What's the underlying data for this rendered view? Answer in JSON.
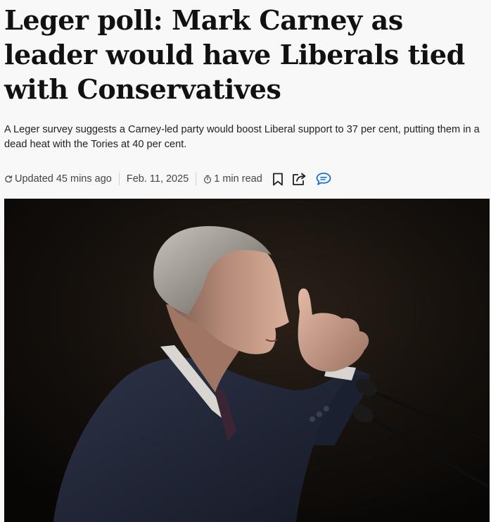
{
  "article": {
    "headline": "Leger poll: Mark Carney as leader would have Liberals tied with Conservatives",
    "deck": "A Leger survey suggests a Carney-led party would boost Liberal support to 37 per cent, putting them in a dead heat with the Tories at 40 per cent."
  },
  "meta": {
    "updated": "Updated 45 mins ago",
    "date": "Feb. 11, 2025",
    "read_time": "1 min read"
  },
  "icons": {
    "updated": "refresh-icon",
    "read_time": "stopwatch-icon",
    "bookmark": "bookmark-icon",
    "share": "share-icon",
    "comments": "comment-icon"
  },
  "colors": {
    "accent": "#1a6fd6",
    "text": "#111111",
    "meta_text": "#444444"
  }
}
